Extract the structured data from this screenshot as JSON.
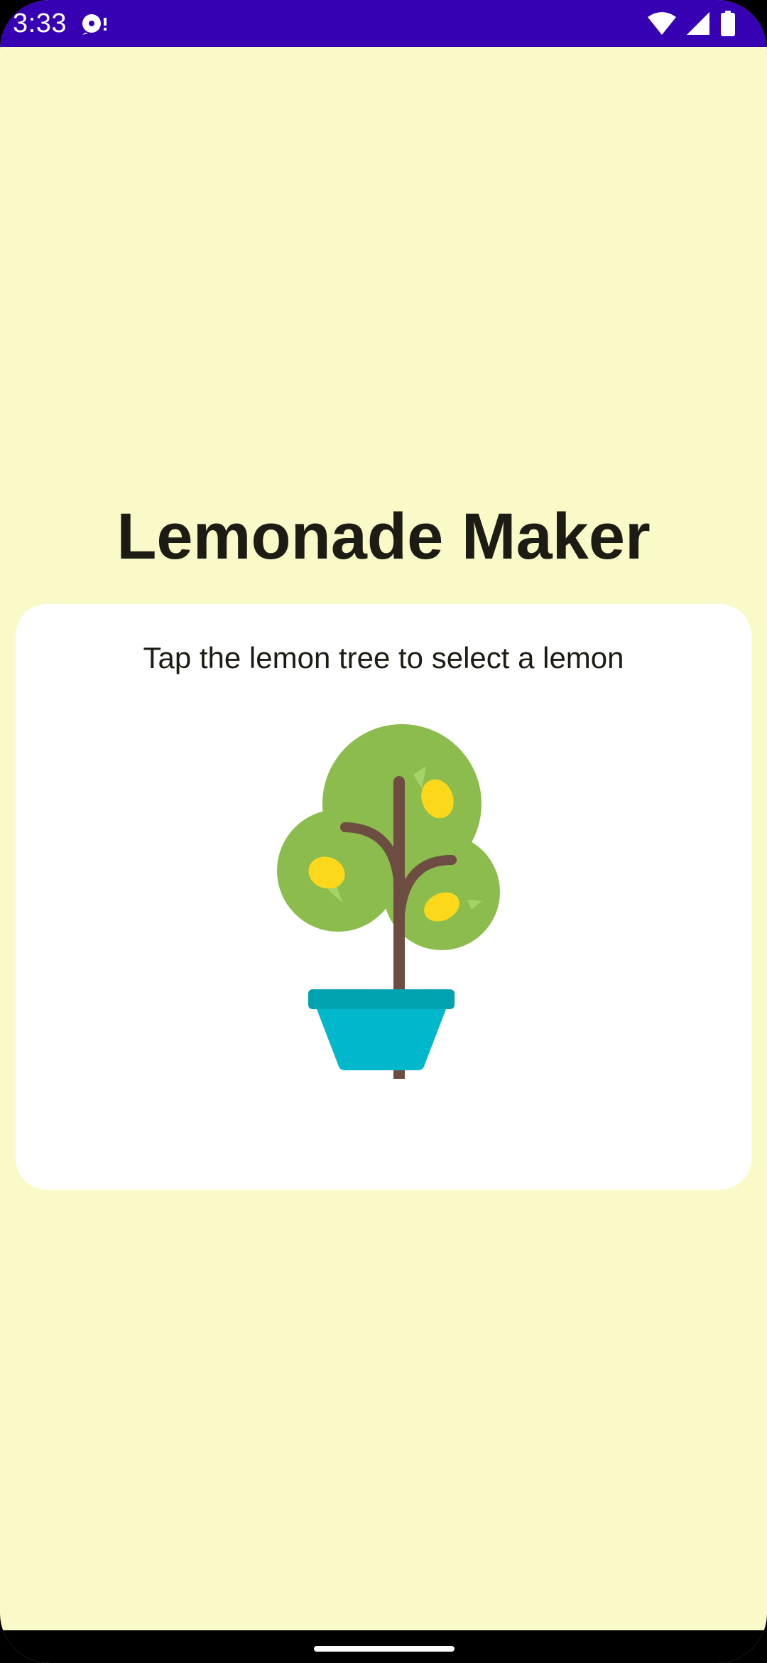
{
  "status_bar": {
    "time": "3:33",
    "notification_icon": "media-notification-icon",
    "wifi_icon": "wifi-icon",
    "signal_icon": "cell-signal-icon",
    "battery_icon": "battery-icon",
    "color": "#3700b3"
  },
  "app": {
    "title": "Lemonade Maker",
    "background_color": "#fafac8"
  },
  "card": {
    "instruction": "Tap the lemon tree to select a lemon",
    "image_icon": "lemon-tree-icon",
    "background_color": "#ffffff"
  },
  "navigation": {
    "handle_icon": "gesture-handle"
  }
}
